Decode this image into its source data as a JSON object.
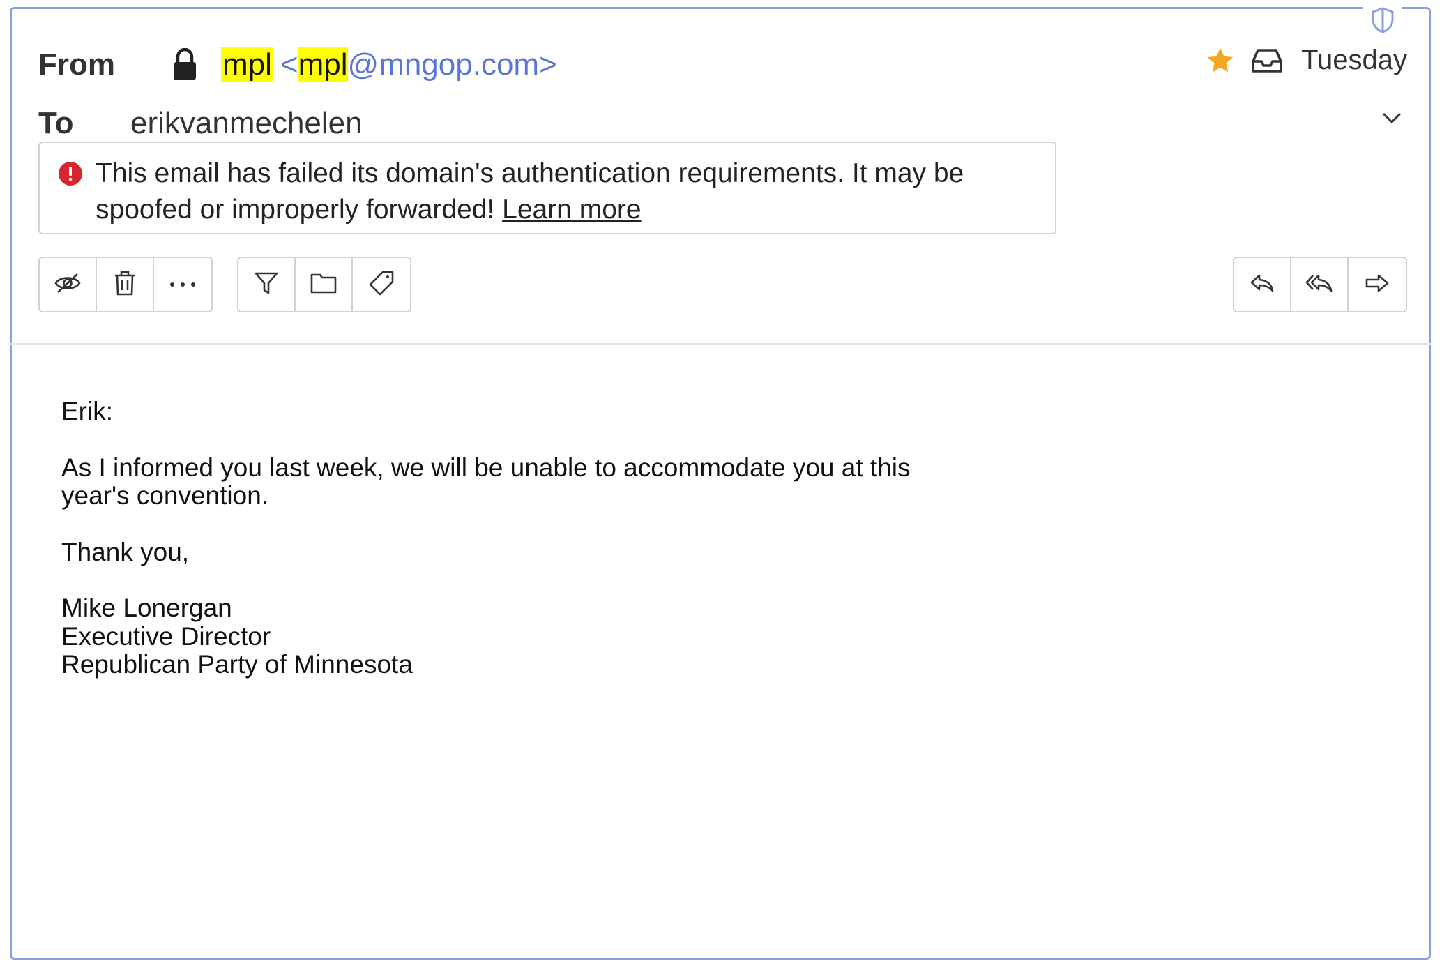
{
  "header": {
    "from_label": "From",
    "to_label": "To",
    "sender_name": "mpl",
    "sender_addr_open": "<",
    "sender_addr_user": "mpl",
    "sender_addr_domain": "@mngop.com>",
    "recipient": "erikvanmechelen",
    "date": "Tuesday"
  },
  "alert": {
    "message": "This email has failed its domain's authentication requirements. It may be spoofed or improperly forwarded! ",
    "link_label": "Learn more"
  },
  "toolbar": {
    "left_group": [
      "hide-icon",
      "trash-icon",
      "more-icon"
    ],
    "middle_group": [
      "filter-icon",
      "folder-icon",
      "tag-icon"
    ],
    "right_group": [
      "reply-icon",
      "reply-all-icon",
      "forward-icon"
    ]
  },
  "body": {
    "greeting": "Erik:",
    "paragraph": "As I informed you last week, we will be unable to accommodate you at this year's convention.",
    "closing": "Thank you,",
    "signature_name": "Mike Lonergan",
    "signature_title": "Executive Director",
    "signature_org": "Republican Party of Minnesota"
  },
  "colors": {
    "frame": "#8b9ee0",
    "highlight": "#ffff00",
    "sender_address": "#5b75d6",
    "star": "#f5a623",
    "alert_icon": "#d9232f"
  }
}
